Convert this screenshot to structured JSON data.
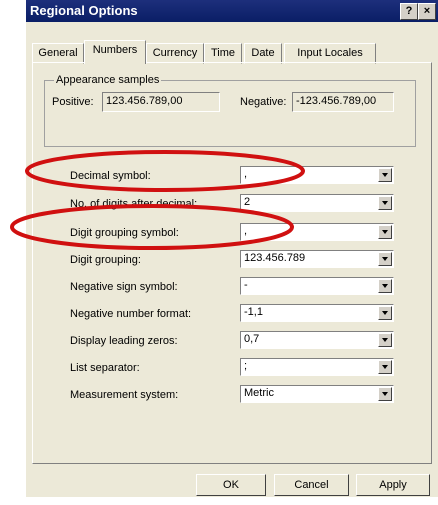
{
  "window": {
    "title": "Regional Options",
    "help_label": "?",
    "close_label": "×"
  },
  "tabs": [
    "General",
    "Numbers",
    "Currency",
    "Time",
    "Date",
    "Input Locales"
  ],
  "active_tab": "Numbers",
  "samples": {
    "group_title": "Appearance samples",
    "positive_label": "Positive:",
    "positive_value": "123.456.789,00",
    "negative_label": "Negative:",
    "negative_value": "-123.456.789,00"
  },
  "settings": [
    {
      "label": "Decimal symbol:",
      "value": ","
    },
    {
      "label": "No. of digits after decimal:",
      "value": "2"
    },
    {
      "label": "Digit grouping symbol:",
      "value": ","
    },
    {
      "label": "Digit grouping:",
      "value": "123.456.789"
    },
    {
      "label": "Negative sign symbol:",
      "value": "-"
    },
    {
      "label": "Negative number format:",
      "value": "-1,1"
    },
    {
      "label": "Display leading zeros:",
      "value": "0,7"
    },
    {
      "label": "List separator:",
      "value": ";"
    },
    {
      "label": "Measurement system:",
      "value": "Metric"
    }
  ],
  "buttons": {
    "ok": "OK",
    "cancel": "Cancel",
    "apply": "Apply"
  },
  "colors": {
    "titlebar": "#0a1e66",
    "dialog": "#ece9d8",
    "highlight_ellipse": "#d01010"
  }
}
